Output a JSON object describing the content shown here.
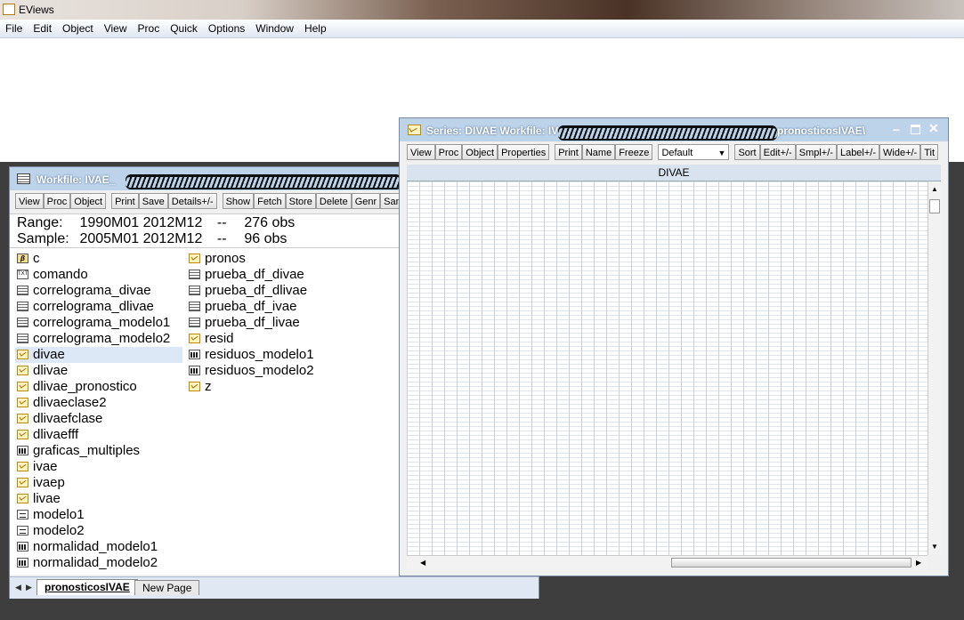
{
  "app": {
    "title": "EViews"
  },
  "menu": [
    "File",
    "Edit",
    "Object",
    "View",
    "Proc",
    "Quick",
    "Options",
    "Window",
    "Help"
  ],
  "workfile": {
    "title_prefix": "Workfile: IVAE_",
    "toolbar": [
      "View",
      "Proc",
      "Object",
      "Print",
      "Save",
      "Details+/-",
      "Show",
      "Fetch",
      "Store",
      "Delete",
      "Genr",
      "Sam"
    ],
    "range_label": "Range:",
    "range_value": "1990M01 2012M12",
    "range_dash": "--",
    "range_obs": "276 obs",
    "sample_label": "Sample:",
    "sample_value": "2005M01 2012M12",
    "sample_dash": "--",
    "sample_obs": "96 obs",
    "objects_col1": [
      {
        "name": "c",
        "icon": "scalar-icon"
      },
      {
        "name": "comando",
        "icon": "text-icon"
      },
      {
        "name": "correlograma_divae",
        "icon": "table-icon"
      },
      {
        "name": "correlograma_dlivae",
        "icon": "table-icon"
      },
      {
        "name": "correlograma_modelo1",
        "icon": "table-icon"
      },
      {
        "name": "correlograma_modelo2",
        "icon": "table-icon"
      },
      {
        "name": "divae",
        "icon": "series-icon"
      },
      {
        "name": "dlivae",
        "icon": "series-icon"
      },
      {
        "name": "dlivae_pronostico",
        "icon": "series-icon"
      },
      {
        "name": "dlivaeclase2",
        "icon": "series-icon"
      },
      {
        "name": "dlivaefclase",
        "icon": "series-icon"
      },
      {
        "name": "dlivaefff",
        "icon": "series-icon"
      },
      {
        "name": "graficas_multiples",
        "icon": "graph-icon"
      },
      {
        "name": "ivae",
        "icon": "series-icon"
      },
      {
        "name": "ivaep",
        "icon": "series-icon"
      },
      {
        "name": "livae",
        "icon": "series-icon"
      },
      {
        "name": "modelo1",
        "icon": "equation-icon"
      },
      {
        "name": "modelo2",
        "icon": "equation-icon"
      },
      {
        "name": "normalidad_modelo1",
        "icon": "graph-icon"
      },
      {
        "name": "normalidad_modelo2",
        "icon": "graph-icon"
      }
    ],
    "objects_col2": [
      {
        "name": "pronos",
        "icon": "series-icon"
      },
      {
        "name": "prueba_df_divae",
        "icon": "table-icon"
      },
      {
        "name": "prueba_df_dlivae",
        "icon": "table-icon"
      },
      {
        "name": "prueba_df_ivae",
        "icon": "table-icon"
      },
      {
        "name": "prueba_df_livae",
        "icon": "table-icon"
      },
      {
        "name": "resid",
        "icon": "series-icon"
      },
      {
        "name": "residuos_modelo1",
        "icon": "graph-icon"
      },
      {
        "name": "residuos_modelo2",
        "icon": "graph-icon"
      },
      {
        "name": "z",
        "icon": "series-icon"
      }
    ],
    "tabs": [
      "pronosticosIVAE",
      "New Page"
    ]
  },
  "series": {
    "title_prefix": "Series: DIVAE   Workfile: IV",
    "title_suffix": "pronosticosIVAE\\",
    "toolbar": [
      "View",
      "Proc",
      "Object",
      "Properties",
      "Print",
      "Name",
      "Freeze",
      "Sort",
      "Edit+/-",
      "Smpl+/-",
      "Label+/-",
      "Wide+/-",
      "Tit"
    ],
    "display_select": "Default",
    "header": "DIVAE",
    "window_controls": [
      "minimize-icon",
      "maximize-icon",
      "close-icon"
    ]
  }
}
